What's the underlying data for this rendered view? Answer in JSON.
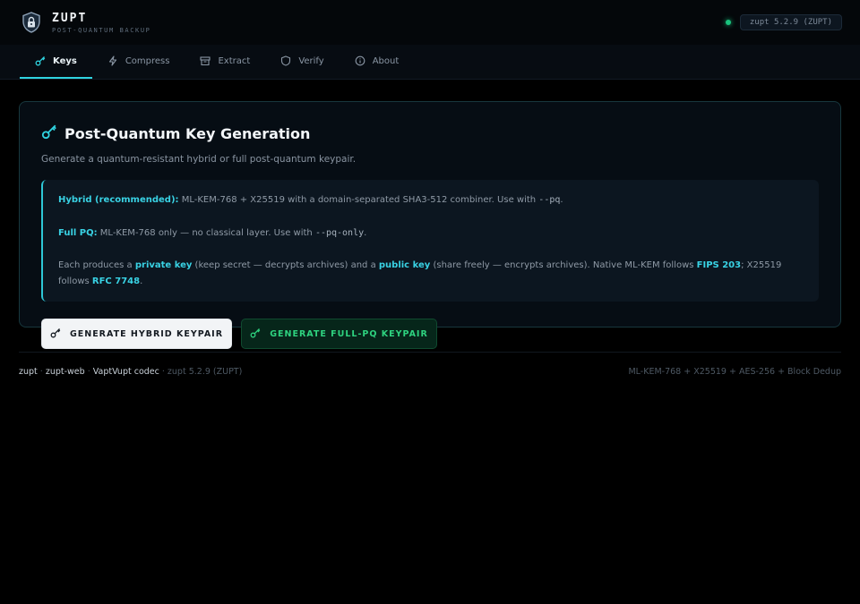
{
  "header": {
    "brand_name": "ZUPT",
    "brand_sub": "POST-QUANTUM BACKUP",
    "logo_icon": "shield-lock-icon",
    "status_color": "#19c37d",
    "version": "zupt 5.2.9 (ZUPT)"
  },
  "nav": {
    "tabs": [
      {
        "label": "Keys",
        "icon": "key-icon",
        "active": true
      },
      {
        "label": "Compress",
        "icon": "lightning-icon",
        "active": false
      },
      {
        "label": "Extract",
        "icon": "archive-box-icon",
        "active": false
      },
      {
        "label": "Verify",
        "icon": "shield-icon",
        "active": false
      },
      {
        "label": "About",
        "icon": "info-icon",
        "active": false
      }
    ]
  },
  "card": {
    "title": "Post-Quantum Key Generation",
    "subtitle": "Generate a quantum-resistant hybrid or full post-quantum keypair.",
    "info": {
      "hybrid_label": "Hybrid (recommended):",
      "hybrid_text": " ML-KEM-768 + X25519 with a domain-separated SHA3-512 combiner. Use with ",
      "hybrid_flag": "--pq",
      "hybrid_end": ".",
      "fullpq_label": "Full PQ:",
      "fullpq_text": " ML-KEM-768 only — no classical layer. Use with ",
      "fullpq_flag": "--pq-only",
      "fullpq_end": ".",
      "each_1": "Each produces a ",
      "private_key": "private key",
      "each_2": " (keep secret — decrypts archives) and a ",
      "public_key": "public key",
      "each_3": " (share freely — encrypts archives). Native ML-KEM follows ",
      "fips": "FIPS 203",
      "each_4": "; X25519 follows ",
      "rfc": "RFC 7748",
      "each_5": "."
    },
    "buttons": {
      "hybrid": "GENERATE HYBRID KEYPAIR",
      "fullpq": "GENERATE FULL-PQ KEYPAIR"
    },
    "accent_color": "#2fd3e0"
  },
  "footer": {
    "links": [
      "zupt",
      "zupt-web",
      "VaptVupt codec"
    ],
    "separator": " · ",
    "version": "zupt 5.2.9 (ZUPT)",
    "right": "ML-KEM-768 + X25519 + AES-256 + Block Dedup"
  }
}
